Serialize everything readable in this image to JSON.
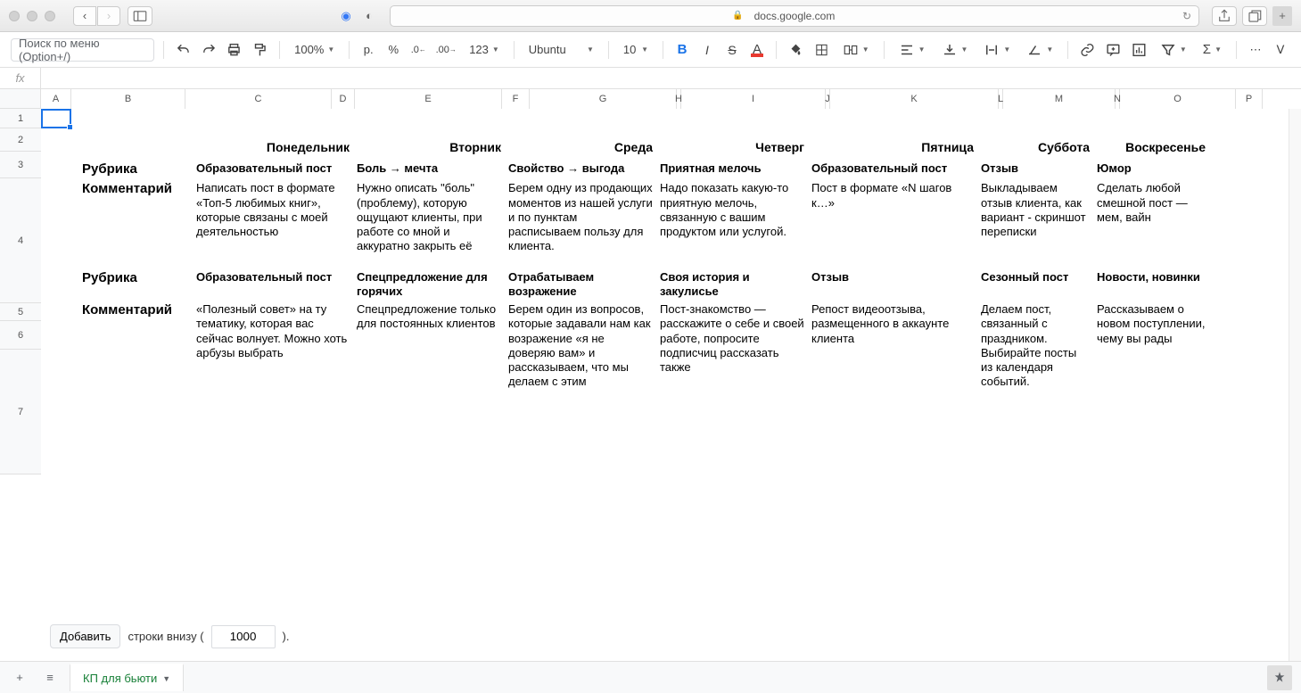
{
  "browser": {
    "url": "docs.google.com"
  },
  "toolbar": {
    "search_placeholder": "Поиск по меню (Option+/)",
    "zoom": "100%",
    "currency": "р.",
    "percent": "%",
    "dec_dec": ".0",
    "dec_inc": ".00",
    "num_fmt": "123",
    "font": "Ubuntu",
    "font_size": "10"
  },
  "columns": [
    "A",
    "B",
    "C",
    "D",
    "E",
    "F",
    "G",
    "H",
    "I",
    "J",
    "K",
    "L",
    "M",
    "N",
    "O",
    "P"
  ],
  "rows": [
    "1",
    "2",
    "3",
    "4",
    "5",
    "6",
    "7"
  ],
  "days": {
    "mon": "Понедельник",
    "tue": "Вторник",
    "wed": "Среда",
    "thu": "Четверг",
    "fri": "Пятница",
    "sat": "Суббота",
    "sun": "Воскресенье"
  },
  "labels": {
    "rubric": "Рубрика",
    "comment": "Комментарий"
  },
  "week1": {
    "rubric": {
      "mon": "Образовательный пост",
      "tue": "Боль → мечта",
      "wed": "Свойство → выгода",
      "thu": "Приятная мелочь",
      "fri": "Образовательный пост",
      "sat": "Отзыв",
      "sun": "Юмор"
    },
    "comment": {
      "mon": "Написать пост в формате «Топ-5 любимых книг», которые связаны с моей деятельностью",
      "tue": "Нужно описать \"боль\" (проблему), которую ощущают клиенты, при работе со мной и аккуратно закрыть её",
      "wed": "Берем одну из продающих моментов из нашей услуги и по пунктам расписываем пользу для клиента.",
      "thu": "Надо показать какую-то приятную мелочь, связанную с вашим продуктом или услугой.",
      "fri": "Пост в формате «N шагов к…»",
      "sat": "Выкладываем отзыв клиента, как вариант - скриншот переписки",
      "sun": "Сделать любой смешной пост — мем, вайн"
    }
  },
  "week2": {
    "rubric": {
      "mon": "Образовательный пост",
      "tue": "Спецпредложение для горячих",
      "wed": "Отрабатываем возражение",
      "thu": "Своя история и закулисье",
      "fri": "Отзыв",
      "sat": "Сезонный пост",
      "sun": "Новости, новинки"
    },
    "comment": {
      "mon": "«Полезный совет» на ту тематику, которая вас сейчас волнует. Можно хоть арбузы выбрать",
      "tue": "Спецпредложение только для постоянных клиентов",
      "wed": "Берем один из вопросов, которые задавали нам как возражение «я не доверяю вам» и рассказываем, что мы делаем с этим",
      "thu": "Пост-знакомство — расскажите о себе и своей работе, попросите подписчиц рассказать также",
      "fri": "Репост видеоотзыва, размещенного в аккаунте клиента",
      "sat": "Делаем пост, связанный с праздником. Выбирайте посты из календаря событий.",
      "sun": "Рассказываем о новом поступлении, чему вы рады"
    }
  },
  "add_rows": {
    "button": "Добавить",
    "text1": "строки внизу (",
    "value": "1000",
    "text2": ")."
  },
  "tab": {
    "name": "КП для бьюти"
  }
}
